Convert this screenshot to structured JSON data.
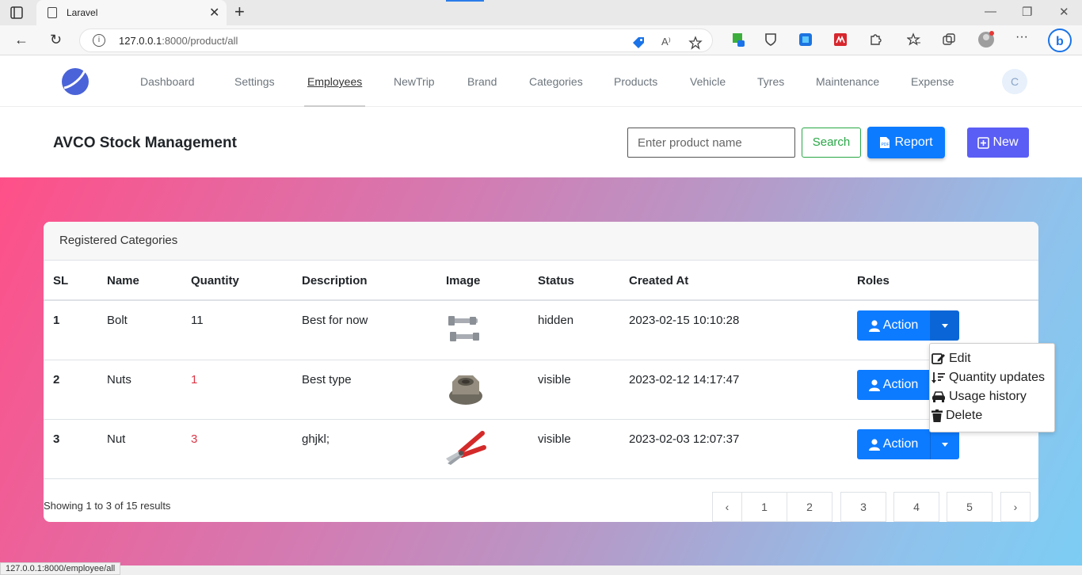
{
  "browser": {
    "tab_title": "Laravel",
    "url_host": "127.0.0.1",
    "url_rest": ":8000/product/all",
    "status_url": "127.0.0.1:8000/employee/all"
  },
  "nav": {
    "items": [
      "Dashboard",
      "Settings",
      "Employees",
      "NewTrip",
      "Brand",
      "Categories",
      "Products",
      "Vehicle",
      "Tyres",
      "Maintenance",
      "Expense"
    ],
    "active": "Employees",
    "avatar_letter": "C"
  },
  "header": {
    "title": "AVCO Stock Management",
    "search_placeholder": "Enter product name",
    "search_label": "Search",
    "report_label": "Report",
    "new_label": "New"
  },
  "card": {
    "title": "Registered Categories",
    "columns": [
      "SL",
      "Name",
      "Quantity",
      "Description",
      "Image",
      "Status",
      "Created At",
      "Roles"
    ],
    "rows": [
      {
        "sl": "1",
        "name": "Bolt",
        "quantity": "11",
        "quantity_low": false,
        "description": "Best for now",
        "image": "bolts-image",
        "status": "hidden",
        "created_at": "2023-02-15 10:10:28",
        "action": "Action"
      },
      {
        "sl": "2",
        "name": "Nuts",
        "quantity": "1",
        "quantity_low": true,
        "description": "Best type",
        "image": "nut-image",
        "status": "visible",
        "created_at": "2023-02-12 14:17:47",
        "action": "Action"
      },
      {
        "sl": "3",
        "name": "Nut",
        "quantity": "3",
        "quantity_low": true,
        "description": "ghjkl;",
        "image": "pliers-image",
        "status": "visible",
        "created_at": "2023-02-03 12:07:37",
        "action": "Action"
      }
    ],
    "footer": "Showing 1 to 3 of 15 results",
    "pages": [
      "1",
      "2",
      "3",
      "4",
      "5"
    ]
  },
  "dropdown": {
    "items": [
      "Edit",
      "Quantity updates",
      "Usage history",
      "Delete"
    ]
  },
  "colors": {
    "primary": "#0d7bff",
    "success": "#28a745",
    "new_btn": "#5b5ef4",
    "danger": "#dc3545"
  }
}
